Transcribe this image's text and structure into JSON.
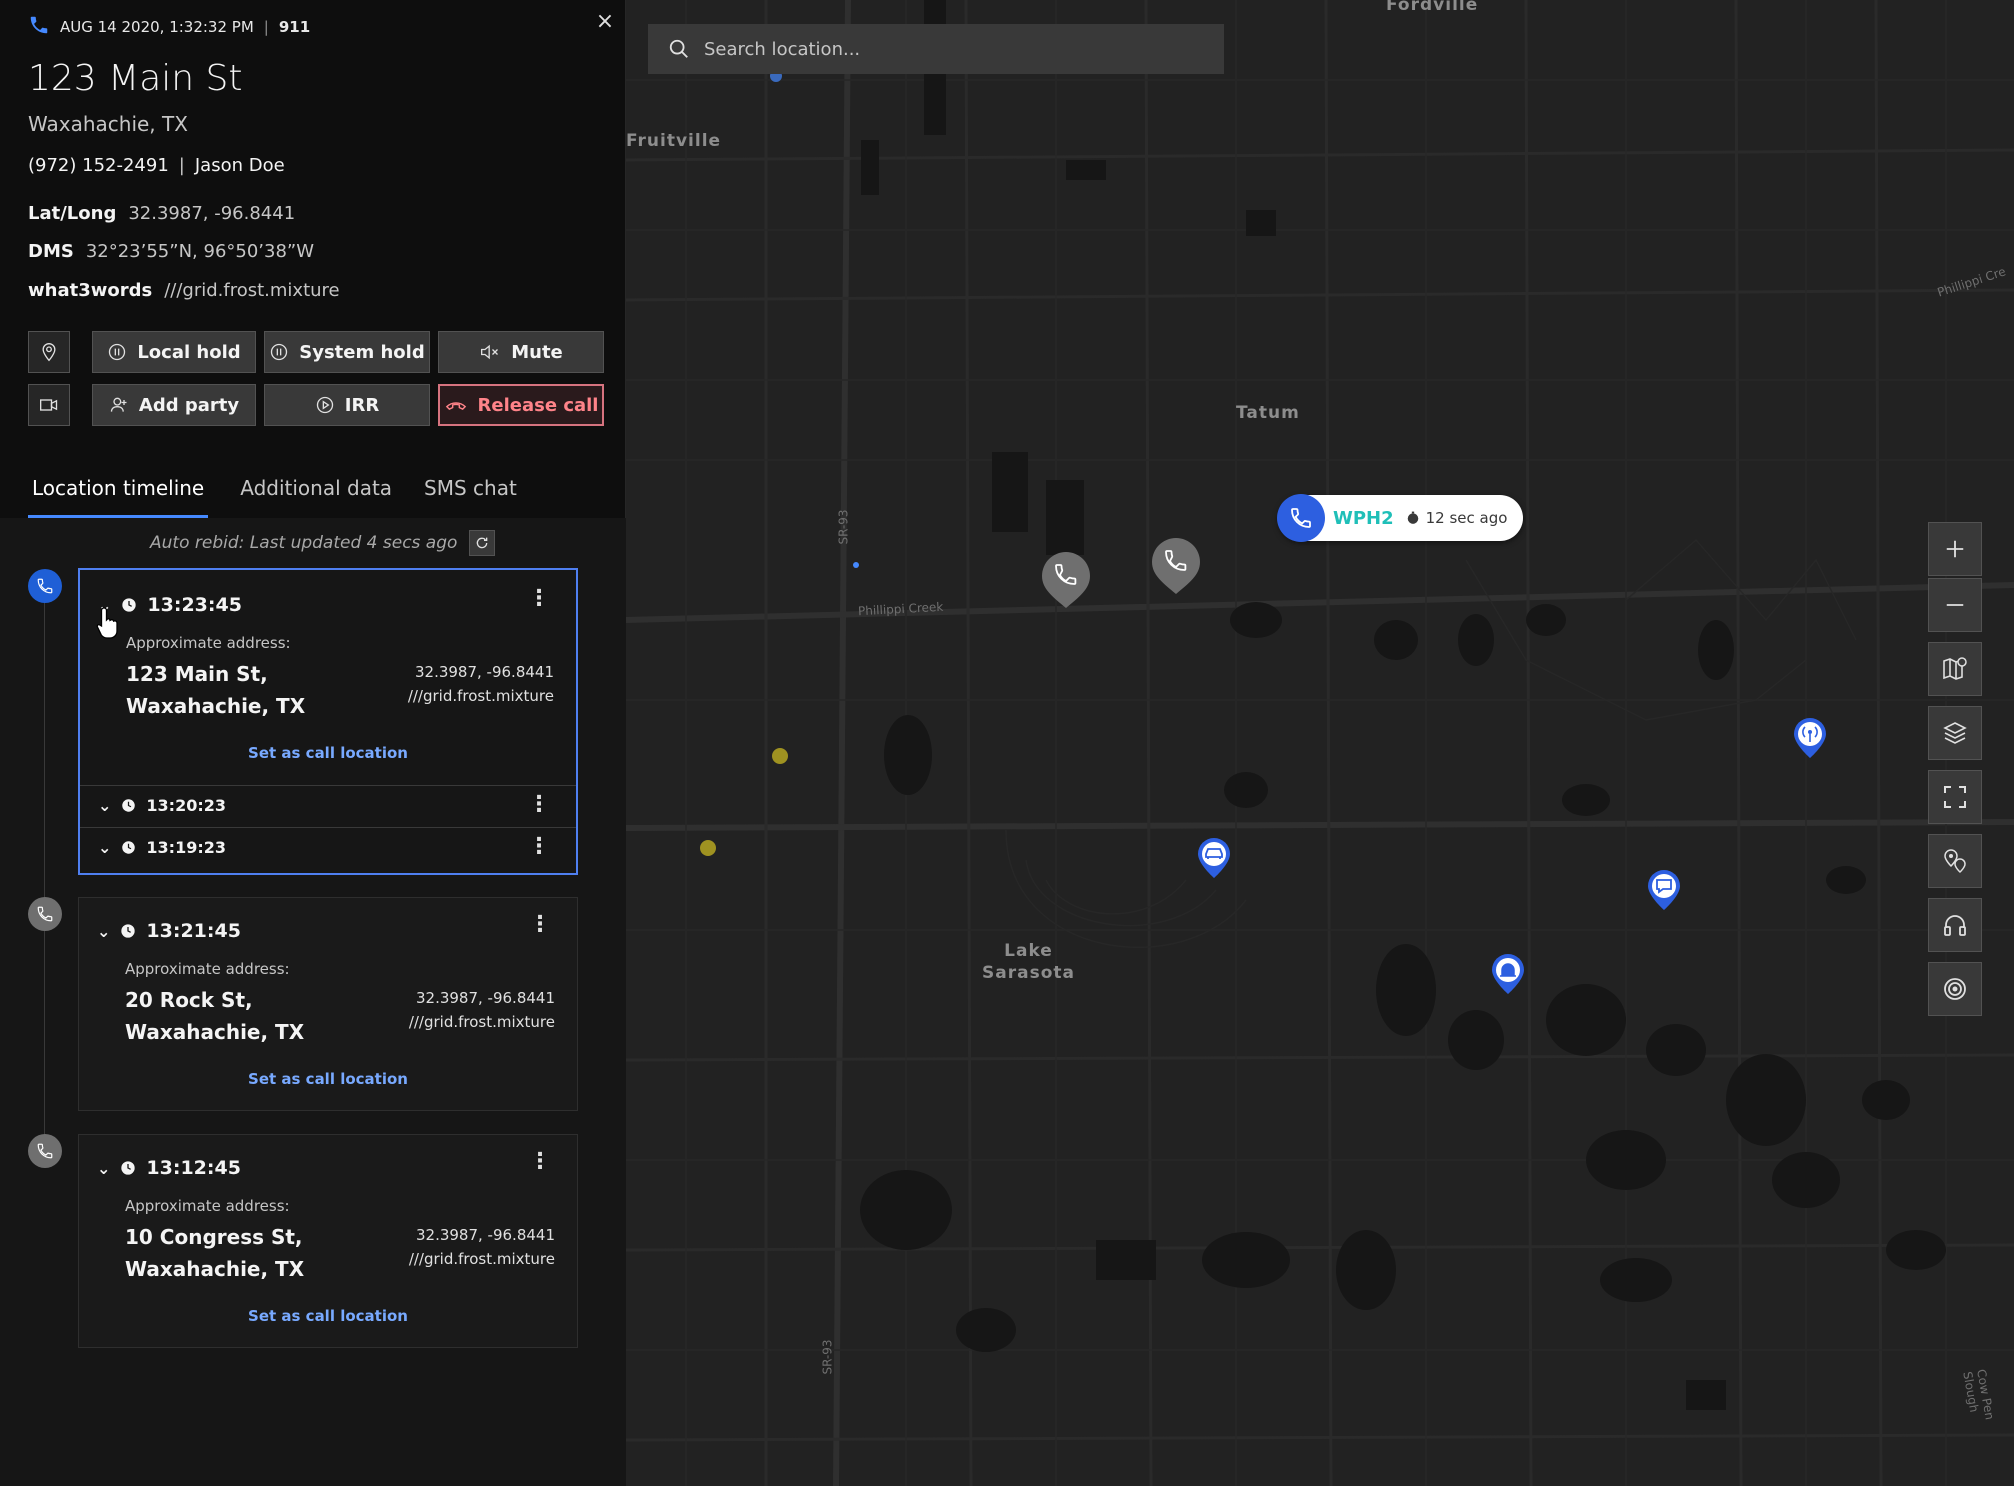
{
  "header": {
    "datetime": "AUG 14 2020, 1:32:32 PM",
    "separator": "|",
    "call_number": "911",
    "close_glyph": "×"
  },
  "location": {
    "street": "123 Main St",
    "city": "Waxahachie, TX",
    "phone": "(972) 152-2491",
    "caller_separator": "|",
    "caller_name": "Jason Doe",
    "latlong_label": "Lat/Long",
    "latlong_value": "32.3987, -96.8441",
    "dms_label": "DMS",
    "dms_value": "32°23’55”N, 96°50’38”W",
    "w3w_label": "what3words",
    "w3w_value": "///grid.frost.mixture"
  },
  "actions": {
    "local_hold": "Local hold",
    "system_hold": "System hold",
    "mute": "Mute",
    "add_party": "Add party",
    "irr": "IRR",
    "release_call": "Release call"
  },
  "tabs": [
    "Location timeline",
    "Additional data",
    "SMS chat"
  ],
  "auto_rebid": "Auto rebid: Last updated 4 secs ago",
  "timeline": [
    {
      "time": "13:23:45",
      "approx_label": "Approximate address:",
      "street": "123 Main St,",
      "city": "Waxahachie, TX",
      "coords": "32.3987, -96.8441",
      "w3w": "///grid.frost.mixture",
      "action": "Set as call location",
      "sub_rows": [
        "13:20:23",
        "13:19:23"
      ]
    },
    {
      "time": "13:21:45",
      "approx_label": "Approximate address:",
      "street": "20 Rock St,",
      "city": "Waxahachie, TX",
      "coords": "32.3987, -96.8441",
      "w3w": "///grid.frost.mixture",
      "action": "Set as call location"
    },
    {
      "time": "13:12:45",
      "approx_label": "Approximate address:",
      "street": "10 Congress St,",
      "city": "Waxahachie, TX",
      "coords": "32.3987, -96.8441",
      "w3w": "///grid.frost.mixture",
      "action": "Set as call location"
    }
  ],
  "map": {
    "search_placeholder": "Search location...",
    "labels": {
      "fordville": "Fordville",
      "fruitville": "Fruitville",
      "tatum": "Tatum",
      "lake_sarasota_1": "Lake",
      "lake_sarasota_2": "Sarasota",
      "sr93_a": "SR-93",
      "sr93_b": "SR-93",
      "phillippi_creek": "Phillippi Creek",
      "phillippi_creek_2": "Phillippi Cre",
      "cow_pen_slough": "Cow Pen Slough"
    },
    "callout": {
      "class_of_service": "WPH2",
      "age": "12 sec ago"
    },
    "tools": [
      "plus-icon",
      "minus-icon",
      "map-icon",
      "layers-icon",
      "fullscreen-icon",
      "locations-icon",
      "headset-icon",
      "target-icon"
    ]
  },
  "colors": {
    "accent_blue": "#4589ff",
    "call_blue": "#2d5fe0",
    "release_red": "#ff8389",
    "wph2_teal": "#1fbfb8",
    "link_blue": "#78a9ff"
  }
}
